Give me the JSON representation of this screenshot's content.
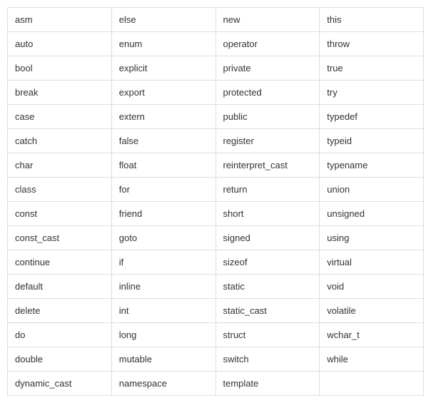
{
  "table": {
    "rows": [
      [
        "asm",
        "else",
        "new",
        "this"
      ],
      [
        "auto",
        "enum",
        "operator",
        "throw"
      ],
      [
        "bool",
        "explicit",
        "private",
        "true"
      ],
      [
        "break",
        "export",
        "protected",
        "try"
      ],
      [
        "case",
        "extern",
        "public",
        "typedef"
      ],
      [
        "catch",
        "false",
        "register",
        "typeid"
      ],
      [
        "char",
        "float",
        "reinterpret_cast",
        "typename"
      ],
      [
        "class",
        "for",
        "return",
        "union"
      ],
      [
        "const",
        "friend",
        "short",
        "unsigned"
      ],
      [
        "const_cast",
        "goto",
        "signed",
        "using"
      ],
      [
        "continue",
        "if",
        "sizeof",
        "virtual"
      ],
      [
        "default",
        "inline",
        "static",
        "void"
      ],
      [
        "delete",
        "int",
        "static_cast",
        "volatile"
      ],
      [
        "do",
        "long",
        "struct",
        "wchar_t"
      ],
      [
        "double",
        "mutable",
        "switch",
        "while"
      ],
      [
        "dynamic_cast",
        "namespace",
        "template",
        ""
      ]
    ]
  }
}
